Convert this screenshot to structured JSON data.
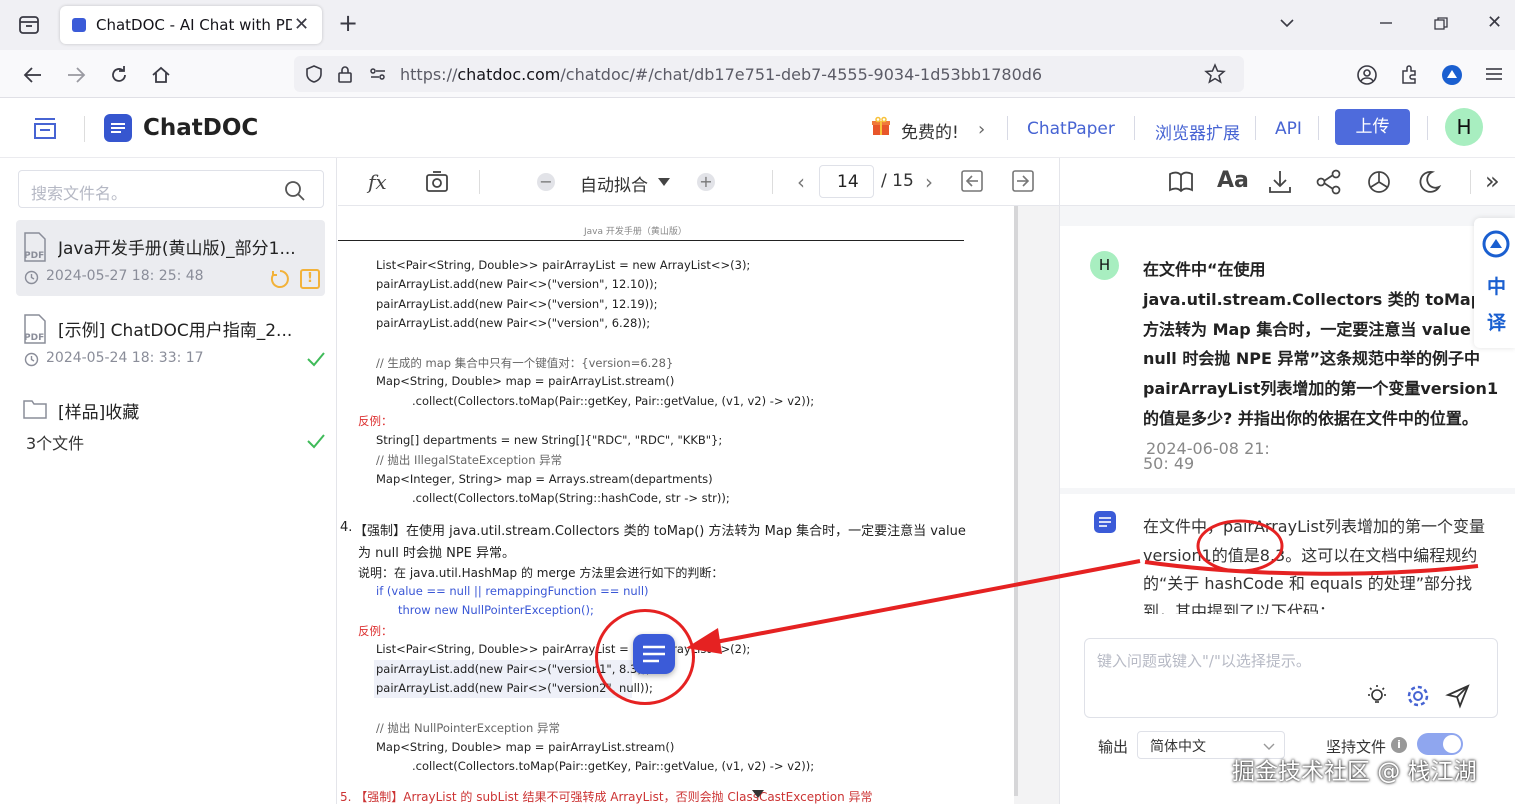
{
  "browser": {
    "tab_title": "ChatDOC - AI Chat with PDF",
    "url_host": "chatdoc.com",
    "url_prefix": "https://",
    "url_path": "/chatdoc/#/chat/db17e751-deb7-4555-9034-1d53bb1780d6"
  },
  "header": {
    "brand": "ChatDOC",
    "free_label": "免费的!",
    "links": [
      "ChatPaper",
      "浏览器扩展",
      "API"
    ],
    "upload_label": "上传",
    "avatar_letter": "H"
  },
  "sidebar": {
    "search_placeholder": "搜索文件名。",
    "items": [
      {
        "name": "Java开发手册(黄山版)_部分1...",
        "time": "2024-05-27 18:  25:  48"
      },
      {
        "name": "[示例] ChatDOC用户指南_2...",
        "time": "2024-05-24 18:  33:  17"
      },
      {
        "name": "[样品]收藏",
        "time": "3个文件"
      }
    ]
  },
  "pdf_toolbar": {
    "zoom_label": "自动拟合",
    "page_current": "14",
    "page_total": "/ 15"
  },
  "pdf_page": {
    "running_header": "Java 开发手册（黄山版）",
    "section4_title": "【强制】在使用 java.util.stream.Collectors 类的 toMap() 方法转为 Map 集合时，一定要注意当 value",
    "section4_title2": "为 null 时会抛 NPE 异常。",
    "section4_num": "4.",
    "note": "说明：在 java.util.HashMap 的 merge 方法里会进行如下的判断：",
    "anti": "反例：",
    "section5": "5. 【强制】ArrayList 的 subList 结果不可强转成 ArrayList，否则会抛 ClassCastException 异常",
    "code_top": [
      "List<Pair<String, Double>> pairArrayList = new ArrayList<>(3);",
      "pairArrayList.add(new Pair<>(\"version\", 12.10));",
      "pairArrayList.add(new Pair<>(\"version\", 12.19));",
      "pairArrayList.add(new Pair<>(\"version\", 6.28));",
      "// 生成的 map 集合中只有一个键值对：{version=6.28}",
      "Map<String, Double> map = pairArrayList.stream()",
      ".collect(Collectors.toMap(Pair::getKey, Pair::getValue, (v1, v2) -> v2));",
      "反例：",
      "String[] departments = new String[]{\"RDC\", \"RDC\", \"KKB\"};",
      "// 抛出 IllegalStateException 异常",
      "Map<Integer, String> map = Arrays.stream(departments)",
      ".collect(Collectors.toMap(String::hashCode, str -> str));"
    ],
    "code_note": [
      "if (value == null || remappingFunction == null)",
      "throw new NullPointerException();"
    ],
    "code_bottom": [
      "List<Pair<String, Double>> pairArrayList = new ArrayList<>(2);",
      "pairArrayList.add(new Pair<>(\"version1\", 8.3));",
      "pairArrayList.add(new Pair<>(\"version2\", null));",
      "// 抛出 NullPointerException 异常",
      "Map<String, Double> map = pairArrayList.stream()",
      ".collect(Collectors.toMap(Pair::getKey, Pair::getValue, (v1, v2) -> v2));"
    ]
  },
  "chat": {
    "user_avatar": "H",
    "question_lines": [
      "在文件中“在使用",
      "java.util.stream.Collectors 类的 toMap(",
      "方法转为 Map 集合时，一定要注意当 value",
      "null 时会抛 NPE 异常”这条规范中举的例子中",
      "pairArrayList列表增加的第一个变量version1",
      "的值是多少? 并指出你的依据在文件中的位置。"
    ],
    "question_time_1": "2024-06-08 21:",
    "question_time_2": "50:  49",
    "answer_lines": [
      "在文件中，pairArrayList列表增加的第一个变量",
      "version1的值是8.3。这可以在文档中编程规约",
      "的“关于 hashCode 和 equals 的处理”部分找",
      "到，其中提到了以下代码："
    ],
    "input_placeholder": "键入问题或键入\"/\"以选择提示。",
    "output_label": "输出",
    "language_value": "简体中文",
    "stick_label": "坚持文件",
    "side_translate": [
      "中",
      "译"
    ]
  },
  "watermark": "掘金技术社区 @ 栈江湖",
  "colors": {
    "accent": "#4e6bdc",
    "annotation_red": "#e52222",
    "link": "#4764d3"
  }
}
